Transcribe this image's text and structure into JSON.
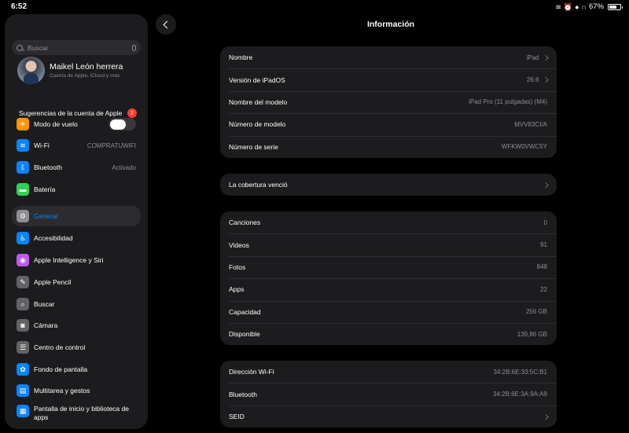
{
  "status_bar": {
    "time": "6:52",
    "battery_percent": "67%",
    "battery_level": 0.67
  },
  "sidebar": {
    "search_placeholder": "Buscar",
    "profile": {
      "name": "Maikel León herrera",
      "subtitle": "Cuenta de Apple, iCloud y más"
    },
    "suggestions": {
      "label": "Sugerencias de la cuenta de Apple",
      "badge": "2"
    },
    "items": [
      {
        "label": "Modo de vuelo",
        "icon": "airplane-icon",
        "color": "#ff9500",
        "toggle": false
      },
      {
        "label": "Wi-Fi",
        "value": "COMPRATUWIFI",
        "icon": "wifi-icon",
        "color": "#0a84ff"
      },
      {
        "label": "Bluetooth",
        "value": "Activado",
        "icon": "bluetooth-icon",
        "color": "#0a84ff"
      },
      {
        "label": "Batería",
        "icon": "battery-icon",
        "color": "#30d158"
      },
      {
        "label": "General",
        "icon": "gear-icon",
        "color": "#8e8e93",
        "selected": true
      },
      {
        "label": "Accesibilidad",
        "icon": "accessibility-icon",
        "color": "#0a84ff"
      },
      {
        "label": "Apple Intelligence y Siri",
        "icon": "siri-icon",
        "color": "#bf5af2"
      },
      {
        "label": "Apple Pencil",
        "icon": "pencil-icon",
        "color": "#636366"
      },
      {
        "label": "Buscar",
        "icon": "search-icon",
        "color": "#636366"
      },
      {
        "label": "Cámara",
        "icon": "camera-icon",
        "color": "#636366"
      },
      {
        "label": "Centro de control",
        "icon": "control-center-icon",
        "color": "#636366"
      },
      {
        "label": "Fondo de pantalla",
        "icon": "wallpaper-icon",
        "color": "#0a84ff"
      },
      {
        "label": "Multitarea y gestos",
        "icon": "multitasking-icon",
        "color": "#0a84ff"
      },
      {
        "label": "Pantalla de inicio y biblioteca de apps",
        "icon": "home-screen-icon",
        "color": "#0a84ff"
      }
    ]
  },
  "main": {
    "title": "Información",
    "groups": [
      [
        {
          "label": "Nombre",
          "value": "iPad",
          "chevron": true
        },
        {
          "label": "Versión de iPadOS",
          "value": "26.6",
          "chevron": true
        },
        {
          "label": "Nombre del modelo",
          "value": "iPad Pro (11 pulgadas) (M4)"
        },
        {
          "label": "Número de modelo",
          "value": "MVV83CI/A"
        },
        {
          "label": "Número de serie",
          "value": "WFKW0VWC5Y"
        }
      ],
      [
        {
          "label": "La cobertura venció",
          "value": "",
          "chevron": true
        }
      ],
      [
        {
          "label": "Canciones",
          "value": "0"
        },
        {
          "label": "Videos",
          "value": "91"
        },
        {
          "label": "Fotos",
          "value": "848"
        },
        {
          "label": "Apps",
          "value": "22"
        },
        {
          "label": "Capacidad",
          "value": "256 GB"
        },
        {
          "label": "Disponible",
          "value": "139,86 GB"
        }
      ],
      [
        {
          "label": "Dirección Wi-Fi",
          "value": "34:2B:6E:33:5C:B1"
        },
        {
          "label": "Bluetooth",
          "value": "34:2B:6E:3A:9A:A9"
        },
        {
          "label": "SEID",
          "value": "",
          "chevron": true
        }
      ]
    ]
  }
}
